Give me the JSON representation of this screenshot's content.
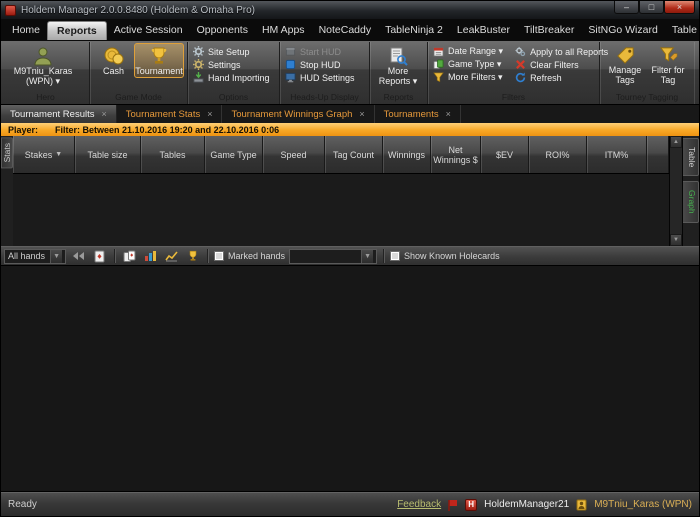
{
  "window": {
    "title": "Holdem Manager 2.0.0.8480 (Holdem & Omaha Pro)"
  },
  "colors": {
    "accent_orange": "#f8a826",
    "tab_orange": "#e6993b",
    "graph_green": "#46b14e",
    "close_red": "#b02a18"
  },
  "menu": {
    "items": [
      "Home",
      "Reports",
      "Active Session",
      "Opponents",
      "HM Apps",
      "NoteCaddy",
      "TableNinja 2",
      "LeakBuster",
      "TiltBreaker",
      "SitNGo Wizard",
      "Table Scanner"
    ],
    "active": "Reports"
  },
  "ribbon": {
    "hero": {
      "name": "M9Tniu_Karas (WPN) ▾",
      "group_label": "Hero"
    },
    "game_mode": {
      "cash": "Cash",
      "tournament": "Tournament",
      "group_label": "Game Mode",
      "selected": "Tournament"
    },
    "options": {
      "site_setup": "Site Setup",
      "settings": "Settings",
      "hand_importing": "Hand Importing",
      "group_label": "Options"
    },
    "hud": {
      "start": "Start HUD",
      "stop": "Stop HUD",
      "settings": "HUD Settings",
      "group_label": "Heads-Up Display"
    },
    "reports_group": {
      "more_reports": "More Reports ▾",
      "group_label": "Reports"
    },
    "filters": {
      "date_range": "Date Range ▾",
      "game_type": "Game Type ▾",
      "more_filters": "More Filters ▾",
      "apply_all": "Apply to all Reports",
      "clear": "Clear Filters",
      "refresh": "Refresh",
      "group_label": "Filters"
    },
    "tagging": {
      "manage_tags": "Manage Tags",
      "filter_for_tag": "Filter for Tag",
      "group_label": "Tourney Tagging"
    }
  },
  "report_tabs": [
    "Tournament Results",
    "Tournament Stats",
    "Tournament Winnings Graph",
    "Tournaments"
  ],
  "filter_bar": {
    "player_label": "Player:",
    "filter_text": "Filter: Between 21.10.2016 19:20 and 22.10.2016 0:06"
  },
  "table": {
    "columns": [
      "Stakes",
      "Table size",
      "Tables",
      "Game Type",
      "Speed",
      "Tag Count",
      "Winnings",
      "Net Winnings $",
      "$EV",
      "ROI%",
      "ITM%"
    ],
    "rows": []
  },
  "side_tabs": {
    "stats": "Stats",
    "table": "Table",
    "graph": "Graph"
  },
  "hands_bar": {
    "all_hands": "All hands",
    "marked_hands_label": "Marked hands",
    "marked_dropdown_value": "",
    "show_known_holecards_label": "Show Known Holecards"
  },
  "status_bar": {
    "ready": "Ready",
    "feedback": "Feedback",
    "account": "HoldemManager21",
    "player": "M9Tniu_Karas (WPN)"
  }
}
